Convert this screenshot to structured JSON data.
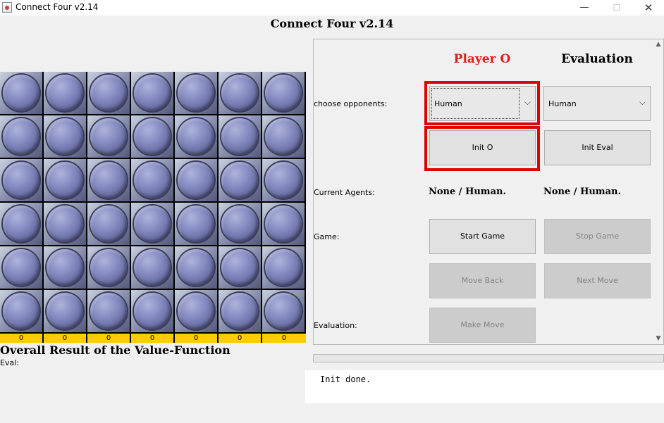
{
  "window": {
    "title": "Connect Four v2.14",
    "minimize_glyph": "—",
    "maximize_glyph": "☐",
    "close_glyph": "✕"
  },
  "main_title": "Connect Four v2.14",
  "board": {
    "columns": 7,
    "rows": 6,
    "disc_color": "#8389bf",
    "column_scores": [
      "0",
      "0",
      "0",
      "0",
      "0",
      "0",
      "0"
    ],
    "score_bar_color": "#ffcc00"
  },
  "overall_title": "Overall Result of the Value-Function",
  "eval_label": "Eval:",
  "panel": {
    "player_o_header": "Player O",
    "player_o_color": "#e41a1a",
    "evaluation_header": "Evaluation",
    "choose_opponents_label": "choose opponents:",
    "player_o_select": "Human",
    "evaluation_select": "Human",
    "init_o_button": "Init O",
    "init_eval_button": "Init Eval",
    "current_agents_label": "Current Agents:",
    "agent_o": "None / Human.",
    "agent_eval": "None / Human.",
    "game_label": "Game:",
    "start_game_button": "Start Game",
    "stop_game_button": "Stop Game",
    "move_back_button": "Move Back",
    "next_move_button": "Next Move",
    "evaluation_label": "Evaluation:",
    "make_move_button": "Make Move",
    "highlight_color": "#e00000"
  },
  "log_text": "Init done."
}
